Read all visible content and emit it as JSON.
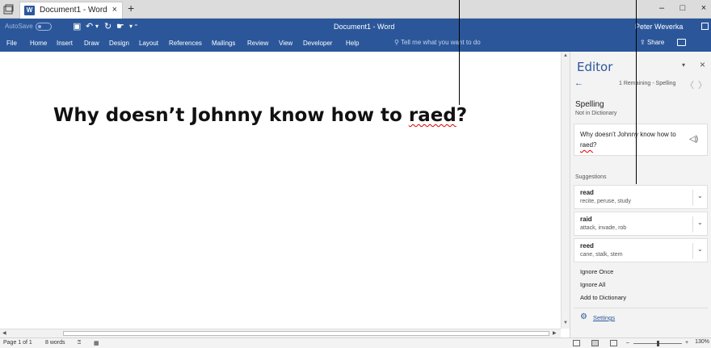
{
  "tabbar": {
    "tab_title": "Document1 - Word",
    "tab_app_letter": "W",
    "close_glyph": "×",
    "new_tab_glyph": "+",
    "minimize_glyph": "–",
    "maximize_glyph": "□",
    "window_close_glyph": "×"
  },
  "titlebar": {
    "autosave_label": "AutoSave",
    "save_glyph": "▣",
    "undo_glyph": "↶",
    "undo_dropdown": "▾",
    "redo_glyph": "↻",
    "touch_mode_glyph": "☛",
    "customize_glyph": "▾ ⁼",
    "document_title": "Document1 - Word",
    "user_name": "Peter Weverka"
  },
  "menu": {
    "items": [
      "File",
      "Home",
      "Insert",
      "Draw",
      "Design",
      "Layout",
      "References",
      "Mailings",
      "Review",
      "View",
      "Developer",
      "Help"
    ],
    "tell_me_icon": "⚲",
    "tell_me_placeholder": "Tell me what you want to do",
    "share_label": "Share",
    "share_icon": "⇪"
  },
  "document": {
    "heading_prefix": "Why doesn’t Johnny know how to ",
    "misspelled_word": "raed",
    "heading_suffix": "?"
  },
  "editor": {
    "title": "Editor",
    "menu_glyph": "▾",
    "close_glyph": "×",
    "back_glyph": "←",
    "remaining": "1 Remaining - Spelling",
    "prev_glyph": "〈",
    "next_glyph": "〉",
    "section_title": "Spelling",
    "section_sub": "Not in Dictionary",
    "context_prefix": "Why doesn’t Johnny know how to ",
    "context_word": "raed",
    "context_suffix": "?",
    "speaker_glyph": "◁)",
    "suggestions_label": "Suggestions",
    "suggestions": [
      {
        "word": "read",
        "synonyms": "recite, peruse, study"
      },
      {
        "word": "raid",
        "synonyms": "attack, invade, rob"
      },
      {
        "word": "reed",
        "synonyms": "cane, stalk, stem"
      }
    ],
    "expand_glyph": "⌄",
    "ignore_once": "Ignore Once",
    "ignore_all": "Ignore All",
    "add_to_dictionary": "Add to Dictionary",
    "settings_glyph": "⚙",
    "settings": "Settings"
  },
  "scroll": {
    "up_glyph": "▲",
    "down_glyph": "▼",
    "left_glyph": "◀",
    "right_glyph": "▶"
  },
  "status": {
    "page": "Page 1 of 1",
    "words": "8 words",
    "proofing_glyph": "⍰",
    "macro_glyph": "▦",
    "zoom_minus": "–",
    "zoom_plus": "+",
    "zoom": "130%",
    "zoom_level_percent": 130
  }
}
